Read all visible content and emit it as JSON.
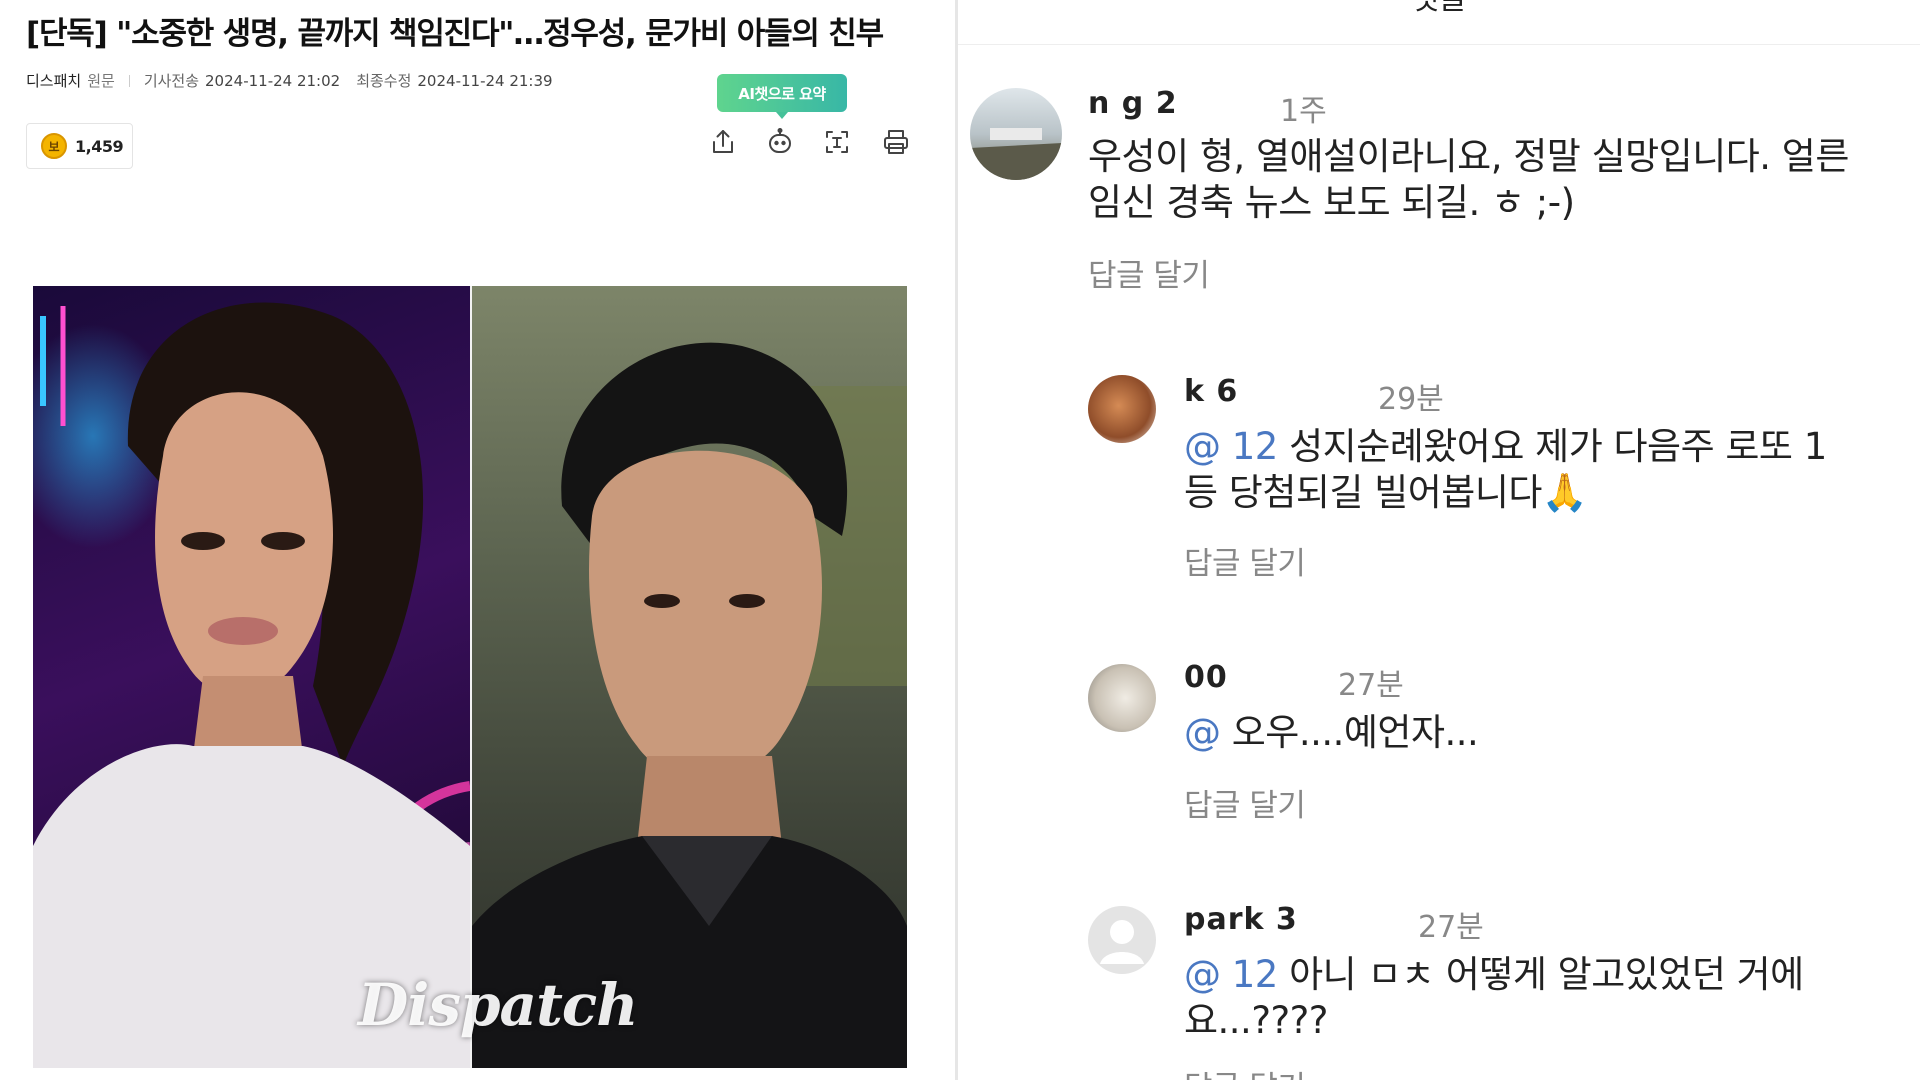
{
  "article": {
    "headline": "[단독] \"소중한 생명, 끝까지 책임진다\"…정우성, 문가비 아들의 친부",
    "source": "디스패치",
    "source_suffix": "원문",
    "sent_label": "기사전송",
    "sent_time": "2024-11-24 21:02",
    "edit_label": "최종수정",
    "edit_time": "2024-11-24 21:39",
    "reaction_icon": "coin-icon",
    "reaction_glyph": "보",
    "reaction_count": "1,459",
    "ai_badge": "AI챗으로 요약",
    "tools": [
      "share-icon",
      "ai-chat-icon",
      "text-size-icon",
      "print-icon"
    ],
    "photo_watermark": "Dispatch"
  },
  "comments_panel": {
    "title": "댓글",
    "comments": [
      {
        "author": "n     g      2",
        "time": "1주",
        "mention": "",
        "text": "우성이 형, 열애설이라니요, 정말 실망입니다. 얼른 임신 경축 뉴스 보도 되길. ㅎ ;-)",
        "reply_label": "답글 달기"
      },
      {
        "author": "k           6",
        "time": "29분",
        "mention": "@           12",
        "text": "성지순례왔어요 제가 다음주 로또 1등 당첨되길 빌어봅니다🙏",
        "reply_label": "답글 달기"
      },
      {
        "author": "        00",
        "time": "27분",
        "mention": "@           ",
        "text": "오우....예언자...",
        "reply_label": "답글 달기"
      },
      {
        "author": "      park     3",
        "time": "27분",
        "mention": "@           12",
        "text": "아니 ㅁㅊ 어떻게 알고있었던 거에요...????",
        "reply_label": "답글 달기"
      }
    ]
  }
}
